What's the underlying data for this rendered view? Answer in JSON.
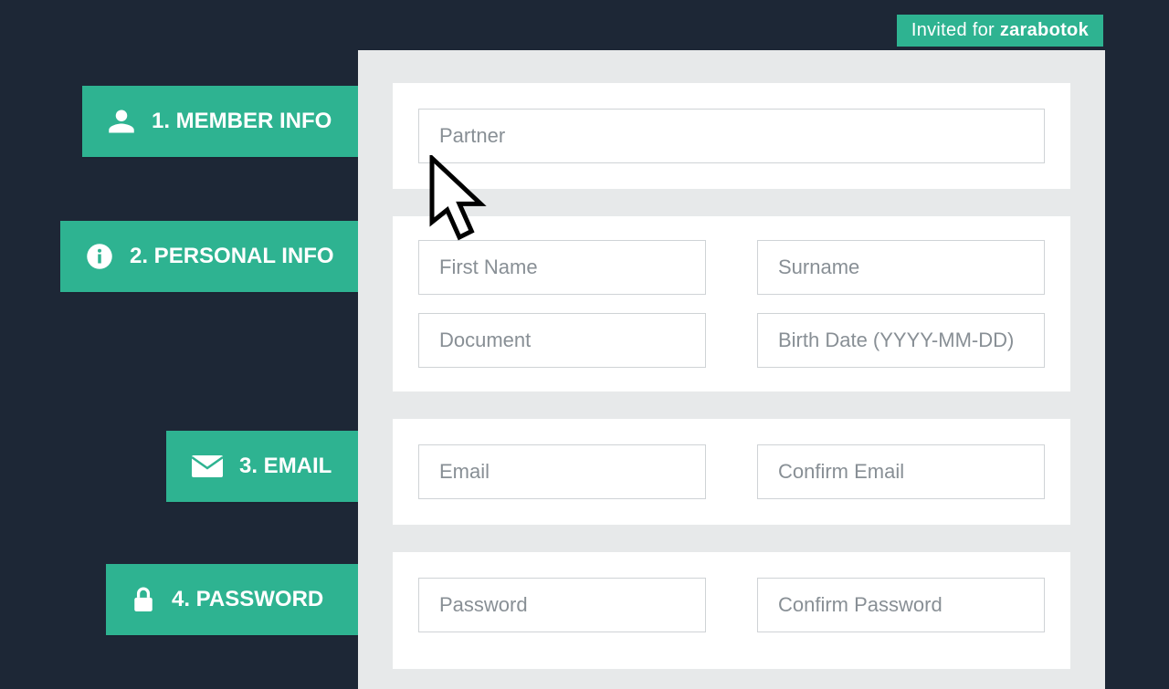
{
  "badge": {
    "prefix": "Invited for ",
    "name": "zarabotok"
  },
  "steps": [
    {
      "label": "1. MEMBER INFO"
    },
    {
      "label": "2. PERSONAL INFO"
    },
    {
      "label": "3. EMAIL"
    },
    {
      "label": "4. PASSWORD"
    }
  ],
  "form": {
    "partner": {
      "placeholder": "Partner"
    },
    "first_name": {
      "placeholder": "First Name"
    },
    "surname": {
      "placeholder": "Surname"
    },
    "document": {
      "placeholder": "Document"
    },
    "birth_date": {
      "placeholder": "Birth Date (YYYY-MM-DD)"
    },
    "email": {
      "placeholder": "Email"
    },
    "confirm_email": {
      "placeholder": "Confirm Email"
    },
    "password": {
      "placeholder": "Password"
    },
    "confirm_password": {
      "placeholder": "Confirm Password"
    }
  }
}
